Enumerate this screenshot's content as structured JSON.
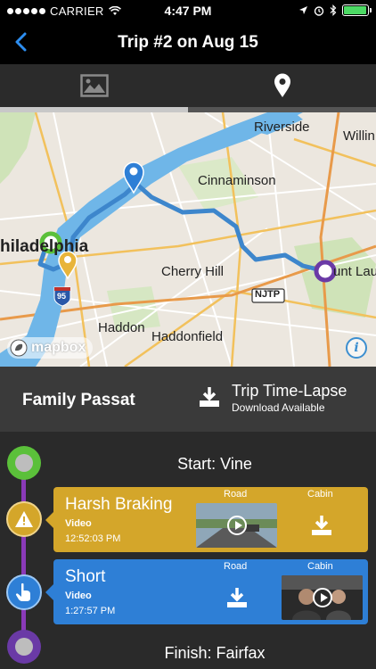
{
  "status_bar": {
    "carrier": "CARRIER",
    "time": "4:47 PM",
    "battery_level": 0.95
  },
  "nav": {
    "title": "Trip #2 on Aug 15",
    "back_icon": "chevron-left-icon"
  },
  "tabs": [
    {
      "name": "photos",
      "icon": "image-icon",
      "active": false
    },
    {
      "name": "map",
      "icon": "map-pin-icon",
      "active": true
    }
  ],
  "map": {
    "labels": {
      "riverside": "Riverside",
      "willing": "Willin",
      "cinnaminson": "Cinnaminson",
      "philadelphia": "hiladelphia",
      "cherry_hill": "Cherry Hill",
      "mount_laurel": "unt Lau",
      "njtp": "NJTP",
      "haddon": "Haddon",
      "haddonfield": "Haddonfield",
      "i95": "95"
    },
    "attribution": "mapbox",
    "info_label": "i",
    "colors": {
      "route": "#3d86cc",
      "water": "#6fb6e8",
      "pin_blue": "#2e7fd6",
      "pin_yellow": "#e8b43a",
      "start": "#5bc03a",
      "finish": "#6a3aa6"
    }
  },
  "vehicle": {
    "name": "Family Passat",
    "timelapse_title": "Trip Time-Lapse",
    "timelapse_subtitle": "Download Available"
  },
  "timeline": {
    "start": "Start: Vine",
    "finish": "Finish: Fairfax",
    "events": [
      {
        "title": "Harsh Braking",
        "type": "Video",
        "time": "12:52:03 PM",
        "road_label": "Road",
        "cabin_label": "Cabin",
        "color": "#d4a62a",
        "icon": "warning-icon"
      },
      {
        "title": "Short",
        "type": "Video",
        "time": "1:27:57 PM",
        "road_label": "Road",
        "cabin_label": "Cabin",
        "color": "#2e7fd6",
        "icon": "tap-hand-icon"
      }
    ]
  }
}
